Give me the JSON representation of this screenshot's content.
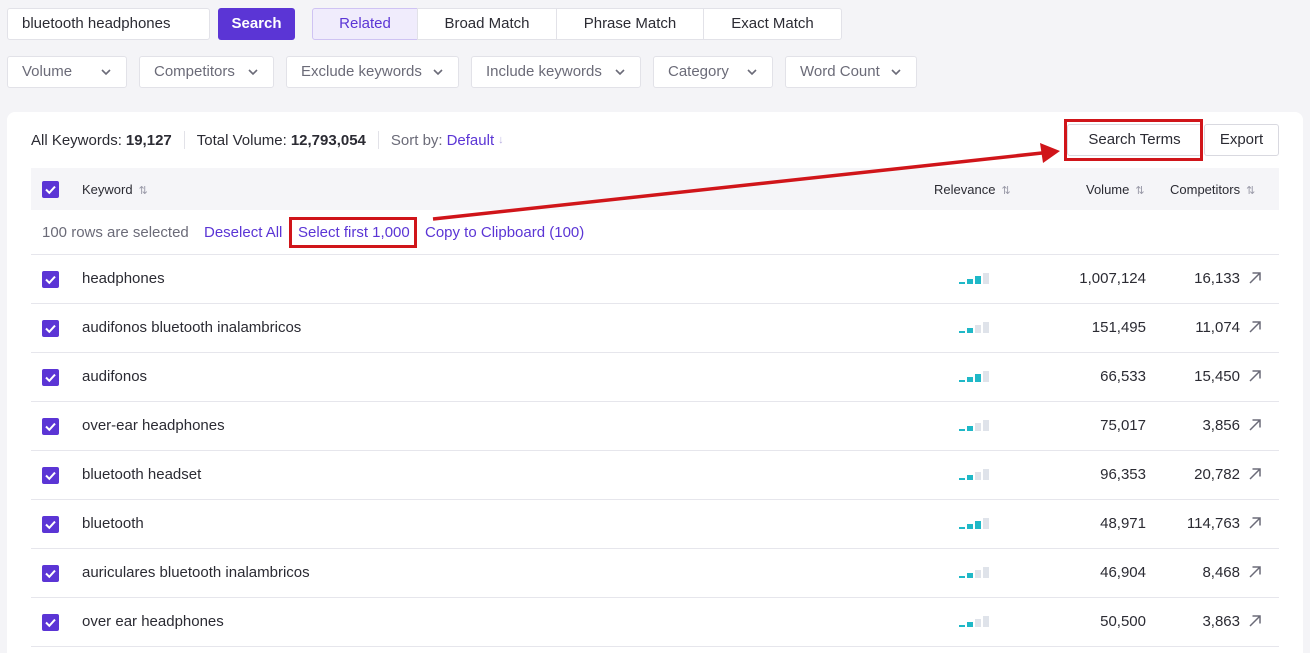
{
  "search": {
    "value": "bluetooth headphones",
    "button": "Search"
  },
  "match_tabs": [
    "Related",
    "Broad Match",
    "Phrase Match",
    "Exact Match"
  ],
  "active_match_tab": "Related",
  "filters": [
    "Volume",
    "Competitors",
    "Exclude keywords",
    "Include keywords",
    "Category",
    "Word Count"
  ],
  "summary": {
    "all_keywords_label": "All Keywords:",
    "all_keywords_value": "19,127",
    "total_volume_label": "Total Volume:",
    "total_volume_value": "12,793,054",
    "sort_label": "Sort by:",
    "sort_value": "Default"
  },
  "actions": {
    "search_terms": "Search Terms",
    "export": "Export"
  },
  "columns": {
    "keyword": "Keyword",
    "relevance": "Relevance",
    "volume": "Volume",
    "competitors": "Competitors"
  },
  "selection": {
    "count_text": "100 rows are selected",
    "deselect": "Deselect All",
    "select_first": "Select first 1,000",
    "copy": "Copy to Clipboard (100)"
  },
  "rows": [
    {
      "keyword": "headphones",
      "relevance": 3,
      "volume": "1,007,124",
      "competitors": "16,133"
    },
    {
      "keyword": "audifonos bluetooth inalambricos",
      "relevance": 2,
      "volume": "151,495",
      "competitors": "11,074"
    },
    {
      "keyword": "audifonos",
      "relevance": 3,
      "volume": "66,533",
      "competitors": "15,450"
    },
    {
      "keyword": "over-ear headphones",
      "relevance": 2,
      "volume": "75,017",
      "competitors": "3,856"
    },
    {
      "keyword": "bluetooth headset",
      "relevance": 2,
      "volume": "96,353",
      "competitors": "20,782"
    },
    {
      "keyword": "bluetooth",
      "relevance": 3,
      "volume": "48,971",
      "competitors": "114,763"
    },
    {
      "keyword": "auriculares bluetooth inalambricos",
      "relevance": 2,
      "volume": "46,904",
      "competitors": "8,468"
    },
    {
      "keyword": "over ear headphones",
      "relevance": 2,
      "volume": "50,500",
      "competitors": "3,863"
    }
  ],
  "relevance_max": 4,
  "colors": {
    "accent": "#5b35d5",
    "relevance_on": "#1fb8c7",
    "relevance_off": "#dfe3ea",
    "annotation": "#d0151a"
  }
}
